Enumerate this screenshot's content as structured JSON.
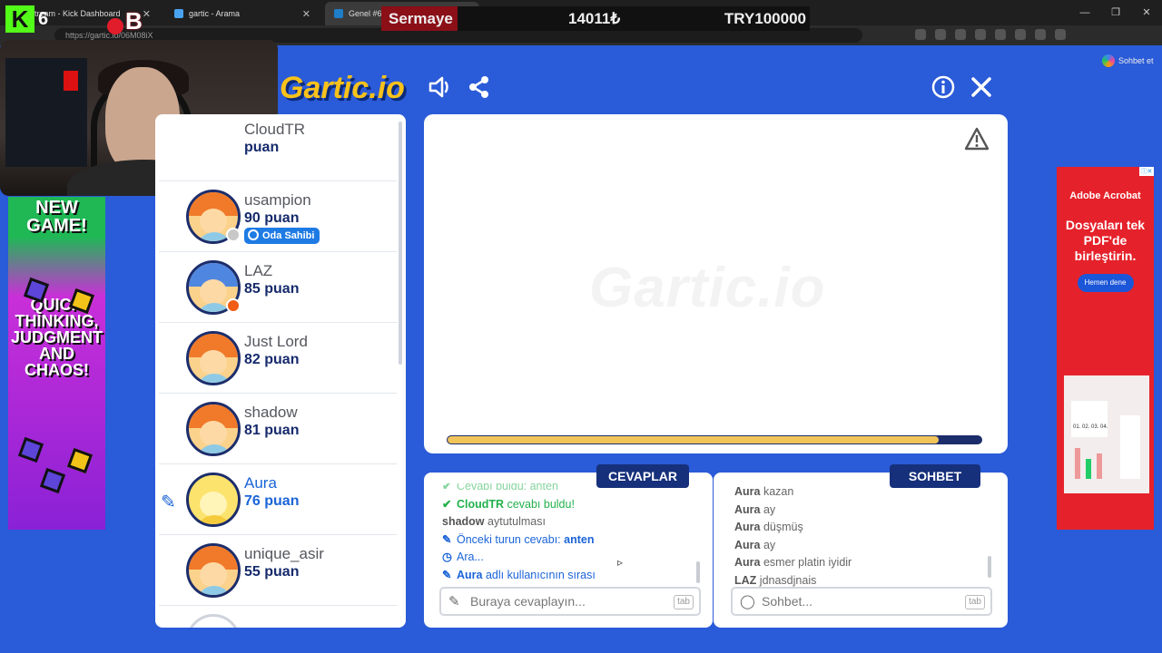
{
  "browser": {
    "tabs": [
      {
        "title": "Stream - Kick Dashboard",
        "active": false
      },
      {
        "title": "gartic - Arama",
        "active": false
      },
      {
        "title": "Genel #6M08iX",
        "active": true
      }
    ],
    "url": "https://gartic.io/06M08iX",
    "copilot_label": "Sohbet et",
    "window_controls": [
      "—",
      "❐",
      "✕"
    ]
  },
  "overlay": {
    "kick_count": "6",
    "kick_logo": "K",
    "b_letter": "B",
    "sermaye_label": "Sermaye",
    "sermaye_value": "14011₺",
    "sermaye_target": "TRY100000"
  },
  "left_ad": {
    "line1": "NEW GAME!",
    "line2": "QUICK THINKING, JUDGMENT AND CHAOS!"
  },
  "right_ad": {
    "brand": "Adobe Acrobat",
    "headline": "Dosyaları tek PDF'de birleştirin.",
    "cta": "Hemen dene",
    "doc_text": "01. 02. 03. 04."
  },
  "header": {
    "logo": "Gartic.io",
    "icons": [
      "volume-icon",
      "share-icon",
      "info-icon",
      "close-icon"
    ]
  },
  "players": [
    {
      "name": "CloudTR",
      "points": "puan",
      "status": ""
    },
    {
      "name": "usampion",
      "points": "90 puan",
      "status": "gray",
      "badge": "Oda Sahibi"
    },
    {
      "name": "LAZ",
      "points": "85 puan",
      "status": "orange"
    },
    {
      "name": "Just Lord",
      "points": "82 puan",
      "status": ""
    },
    {
      "name": "shadow",
      "points": "81 puan",
      "status": ""
    },
    {
      "name": "Aura",
      "points": "76 puan",
      "status": "",
      "drawing": true
    },
    {
      "name": "unique_asir",
      "points": "55 puan",
      "status": ""
    }
  ],
  "canvas": {
    "watermark": "Gartic.io",
    "timer_progress": 0.92
  },
  "answers": {
    "tab_label": "CEVAPLAR",
    "messages": [
      {
        "type": "green",
        "icon": "✔",
        "user": "",
        "text": "Cevabı buldu: anten"
      },
      {
        "type": "green",
        "icon": "✔",
        "user": "CloudTR",
        "text": "cevabı buldu!"
      },
      {
        "type": "plain",
        "icon": "",
        "user": "shadow",
        "text": "aytutulması"
      },
      {
        "type": "blue",
        "icon": "✎",
        "user": "",
        "text": "Önceki turun cevabı:",
        "highlight": "anten"
      },
      {
        "type": "blue",
        "icon": "◷",
        "user": "",
        "text": "Ara..."
      },
      {
        "type": "blue",
        "icon": "✎",
        "user": "Aura",
        "text": "adlı kullanıcının sırası"
      }
    ],
    "input_placeholder": "Buraya cevaplayın...",
    "input_hint": "tab"
  },
  "chat": {
    "tab_label": "SOHBET",
    "messages": [
      {
        "user": "Aura",
        "text": "kazan"
      },
      {
        "user": "Aura",
        "text": "ay"
      },
      {
        "user": "Aura",
        "text": "düşmüş"
      },
      {
        "user": "Aura",
        "text": "ay"
      },
      {
        "user": "Aura",
        "text": "esmer platin iyidir"
      },
      {
        "user": "LAZ",
        "text": "jdnasdjnais"
      }
    ],
    "input_placeholder": "Sohbet...",
    "input_hint": "tab"
  },
  "colors": {
    "background": "#2a5bd8",
    "navy": "#16307b",
    "accent_blue": "#1b64d8",
    "timer_yellow": "#f1c45a",
    "correct_green": "#22b14c"
  }
}
